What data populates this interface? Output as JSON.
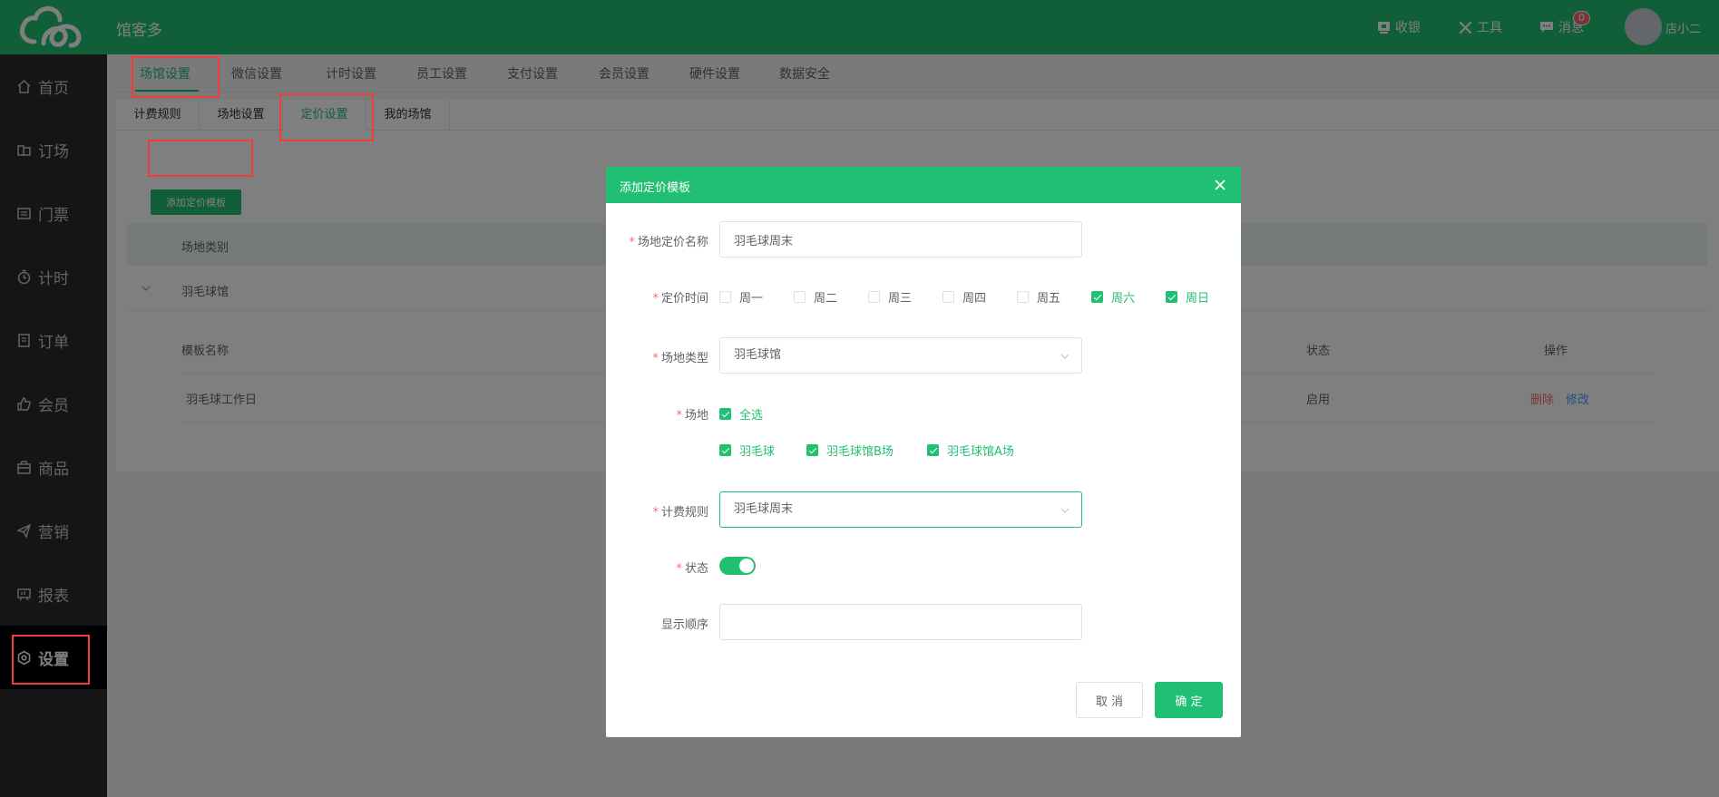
{
  "header": {
    "app_name": "馆客多",
    "cashier_label": "收银",
    "tools_label": "工具",
    "messages_label": "消息",
    "messages_count": "0",
    "user_name": "店小二"
  },
  "sidebar": {
    "items": [
      {
        "label": "首页",
        "icon": "home-icon"
      },
      {
        "label": "订场",
        "icon": "booking-icon"
      },
      {
        "label": "门票",
        "icon": "ticket-icon"
      },
      {
        "label": "计时",
        "icon": "timer-icon"
      },
      {
        "label": "订单",
        "icon": "order-icon"
      },
      {
        "label": "会员",
        "icon": "member-icon"
      },
      {
        "label": "商品",
        "icon": "goods-icon"
      },
      {
        "label": "营销",
        "icon": "marketing-icon"
      },
      {
        "label": "报表",
        "icon": "report-icon"
      },
      {
        "label": "设置",
        "icon": "settings-icon",
        "active": true
      }
    ]
  },
  "settings_tabs": [
    "场馆设置",
    "微信设置",
    "计时设置",
    "员工设置",
    "支付设置",
    "会员设置",
    "硬件设置",
    "数据安全"
  ],
  "venue_subtabs": [
    "计费规则",
    "场地设置",
    "定价设置",
    "我的场馆"
  ],
  "add_template_label": "添加定价模板",
  "table": {
    "category_header": "场地类别",
    "category_value": "羽毛球馆",
    "sub_headers": {
      "name": "模板名称",
      "status": "状态",
      "actions": "操作"
    },
    "rows": [
      {
        "name": "羽毛球工作日",
        "status": "启用",
        "delete": "删除",
        "edit": "修改"
      }
    ]
  },
  "modal": {
    "title": "添加定价模板",
    "name_label": "场地定价名称",
    "name_value": "羽毛球周末",
    "time_label": "定价时间",
    "weekdays": [
      {
        "label": "周一",
        "checked": false
      },
      {
        "label": "周二",
        "checked": false
      },
      {
        "label": "周三",
        "checked": false
      },
      {
        "label": "周四",
        "checked": false
      },
      {
        "label": "周五",
        "checked": false
      },
      {
        "label": "周六",
        "checked": true
      },
      {
        "label": "周日",
        "checked": true
      }
    ],
    "type_label": "场地类型",
    "type_value": "羽毛球馆",
    "field_label": "场地",
    "select_all_label": "全选",
    "fields": [
      {
        "label": "羽毛球",
        "checked": true
      },
      {
        "label": "羽毛球馆B场",
        "checked": true
      },
      {
        "label": "羽毛球馆A场",
        "checked": true
      }
    ],
    "rule_label": "计费规则",
    "rule_value": "羽毛球周末",
    "status_label": "状态",
    "status_on": true,
    "order_label": "显示顺序",
    "order_value": "",
    "cancel_label": "取 消",
    "ok_label": "确 定"
  },
  "colors": {
    "brand": "#21bf73",
    "sidebar": "#2b2b2b",
    "danger": "#f56c6c",
    "link": "#409eff",
    "annotation": "#f23b3b"
  }
}
